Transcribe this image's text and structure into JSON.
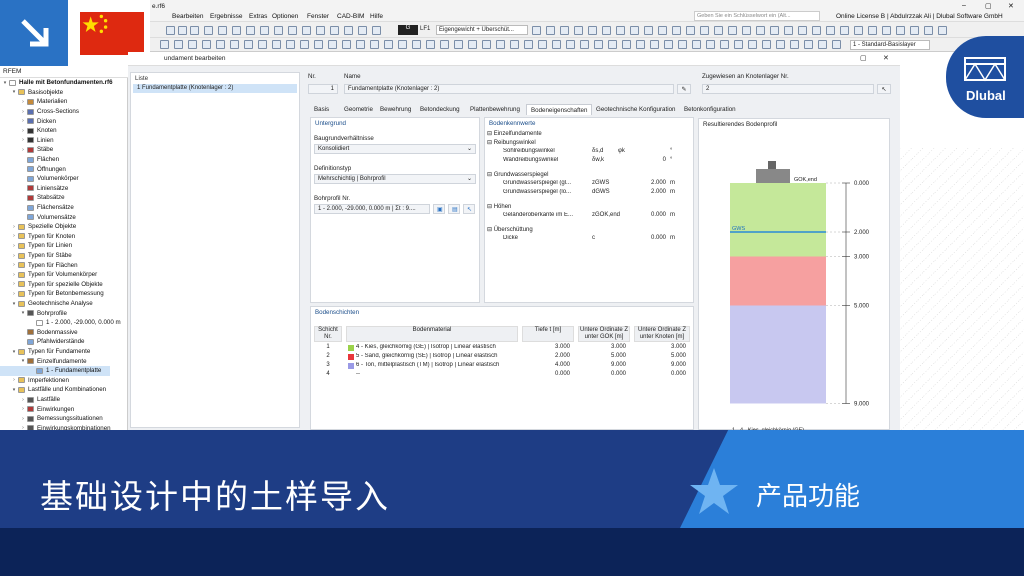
{
  "app": {
    "title_fragment": "e.rf6"
  },
  "menu": [
    "Bearbeiten",
    "Ergebnisse",
    "Extras",
    "Optionen",
    "Fenster",
    "CAD-BIM",
    "Hilfe"
  ],
  "search": {
    "placeholder": "Geben Sie ein Schlüsselwort ein (Alt..."
  },
  "license": "Online License B | Abdulrzzak Ali | Dlubal Software GmbH",
  "toolbar": {
    "lc_code": "G",
    "lc_name": "LF1",
    "lc_desc": "Eigengewicht + Überschüt...",
    "layer": "1 - Standard-Basislayer"
  },
  "navigator": {
    "header": "RFEM",
    "items": [
      {
        "label": "Halle mit Betonfundamenten.rf6",
        "lvl": 0,
        "bold": true,
        "exp": "▾",
        "color": "#ffffff"
      },
      {
        "label": "Basisobjekte",
        "lvl": 1,
        "exp": "▾",
        "color": "#e8c25a"
      },
      {
        "label": "Materialien",
        "lvl": 2,
        "exp": "›",
        "color": "#c58a3a"
      },
      {
        "label": "Cross-Sections",
        "lvl": 2,
        "exp": "›",
        "color": "#5a6fb0"
      },
      {
        "label": "Dicken",
        "lvl": 2,
        "exp": "›",
        "color": "#5a6fb0"
      },
      {
        "label": "Knoten",
        "lvl": 2,
        "exp": "›",
        "color": "#333333"
      },
      {
        "label": "Linien",
        "lvl": 2,
        "exp": "›",
        "color": "#333333"
      },
      {
        "label": "Stäbe",
        "lvl": 2,
        "exp": "›",
        "color": "#b03a3a"
      },
      {
        "label": "Flächen",
        "lvl": 2,
        "exp": "",
        "color": "#7fa6d8"
      },
      {
        "label": "Öffnungen",
        "lvl": 2,
        "exp": "",
        "color": "#7fa6d8"
      },
      {
        "label": "Volumenkörper",
        "lvl": 2,
        "exp": "",
        "color": "#7fa6d8"
      },
      {
        "label": "Liniensätze",
        "lvl": 2,
        "exp": "",
        "color": "#b03a3a"
      },
      {
        "label": "Stabsätze",
        "lvl": 2,
        "exp": "",
        "color": "#b03a3a"
      },
      {
        "label": "Flächensätze",
        "lvl": 2,
        "exp": "",
        "color": "#7fa6d8"
      },
      {
        "label": "Volumensätze",
        "lvl": 2,
        "exp": "",
        "color": "#7fa6d8"
      },
      {
        "label": "Spezielle Objekte",
        "lvl": 1,
        "exp": "›",
        "color": "#e8c25a"
      },
      {
        "label": "Typen für Knoten",
        "lvl": 1,
        "exp": "›",
        "color": "#e8c25a"
      },
      {
        "label": "Typen für Linien",
        "lvl": 1,
        "exp": "›",
        "color": "#e8c25a"
      },
      {
        "label": "Typen für Stäbe",
        "lvl": 1,
        "exp": "›",
        "color": "#e8c25a"
      },
      {
        "label": "Typen für Flächen",
        "lvl": 1,
        "exp": "›",
        "color": "#e8c25a"
      },
      {
        "label": "Typen für Volumenkörper",
        "lvl": 1,
        "exp": "›",
        "color": "#e8c25a"
      },
      {
        "label": "Typen für spezielle Objekte",
        "lvl": 1,
        "exp": "›",
        "color": "#e8c25a"
      },
      {
        "label": "Typen für Betonbemessung",
        "lvl": 1,
        "exp": "›",
        "color": "#e8c25a"
      },
      {
        "label": "Geotechnische Analyse",
        "lvl": 1,
        "exp": "▾",
        "color": "#e8c25a"
      },
      {
        "label": "Bohrprofile",
        "lvl": 2,
        "exp": "▾",
        "color": "#555555"
      },
      {
        "label": "1 - 2.000, -29.000, 0.000 m",
        "lvl": 3,
        "exp": "",
        "color": "#ffffff"
      },
      {
        "label": "Bodenmassive",
        "lvl": 2,
        "exp": "",
        "color": "#a0703a"
      },
      {
        "label": "Pfahlwiderstände",
        "lvl": 2,
        "exp": "",
        "color": "#7fa6d8"
      },
      {
        "label": "Typen für Fundamente",
        "lvl": 1,
        "exp": "▾",
        "color": "#e8c25a"
      },
      {
        "label": "Einzelfundamente",
        "lvl": 2,
        "exp": "▾",
        "color": "#a0703a"
      },
      {
        "label": "1 - Fundamentplatte",
        "lvl": 3,
        "exp": "",
        "color": "#7fa6d8",
        "sel": true
      },
      {
        "label": "Imperfektionen",
        "lvl": 1,
        "exp": "›",
        "color": "#e8c25a"
      },
      {
        "label": "Lastfälle und Kombinationen",
        "lvl": 1,
        "exp": "▾",
        "color": "#e8c25a"
      },
      {
        "label": "Lastfälle",
        "lvl": 2,
        "exp": "›",
        "color": "#555555"
      },
      {
        "label": "Einwirkungen",
        "lvl": 2,
        "exp": "›",
        "color": "#b03a3a"
      },
      {
        "label": "Bemessungssituationen",
        "lvl": 2,
        "exp": "›",
        "color": "#555555"
      },
      {
        "label": "Einwirkungskombinationen",
        "lvl": 2,
        "exp": "›",
        "color": "#555555"
      }
    ]
  },
  "dialog": {
    "title": "undament bearbeiten",
    "list_header": "Liste",
    "list_item": "1   Fundamentplatte (Knotenlager : 2)",
    "no_label": "Nr.",
    "no_value": "1",
    "name_label": "Name",
    "name_value": "Fundamentplatte (Knotenlager : 2)",
    "assign_label": "Zugewiesen an Knotenlager Nr.",
    "assign_value": "2",
    "tabs": [
      "Basis",
      "Geometrie",
      "Bewehrung",
      "Betondeckung",
      "Plattenbewehrung",
      "Bodeneigenschaften",
      "Geotechnische Konfiguration",
      "Betonkonfiguration"
    ],
    "active_tab": 5,
    "untergrund": {
      "header": "Untergrund",
      "soil_label": "Baugrundverhältnisse",
      "soil_value": "Konsolidiert",
      "def_label": "Definitionstyp",
      "def_value": "Mehrschichtig | Bohrprofil",
      "bore_label": "Bohrprofil Nr.",
      "bore_value": "1 - 2.000, -29.000, 0.000 m | Σt : 9...."
    },
    "kennwerte": {
      "header": "Bodenkennwerte",
      "groups": [
        {
          "title": "Einzelfundamente",
          "rows": []
        },
        {
          "title": "Reibungswinkel",
          "rows": [
            {
              "name": "Sohlreibungswinkel",
              "sym": "δs,d",
              "val": "φk",
              "unit": "°"
            },
            {
              "name": "Wandreibungswinkel",
              "sym": "δw,k",
              "val": "0",
              "unit": "°"
            }
          ]
        },
        {
          "title": "Grundwasserspiegel",
          "rows": [
            {
              "name": "Grundwasserspiegel (gl...",
              "sym": "zGWS",
              "val": "2.000",
              "unit": "m"
            },
            {
              "name": "Grundwasserspiegel (lo...",
              "sym": "dGWS",
              "val": "2.000",
              "unit": "m"
            }
          ]
        },
        {
          "title": "Höhen",
          "rows": [
            {
              "name": "Geländeroberkante im E...",
              "sym": "zGOK,end",
              "val": "0.000",
              "unit": "m"
            }
          ]
        },
        {
          "title": "Überschüttung",
          "rows": [
            {
              "name": "Dicke",
              "sym": "c",
              "val": "0.000",
              "unit": "m"
            }
          ]
        }
      ]
    },
    "schichten": {
      "header": "Bodenschichten",
      "columns": [
        "Schicht Nr.",
        "Bodenmaterial",
        "Tiefe t [m]",
        "Untere Ordinate Z unter GOK [m]",
        "Untere Ordinate Z unter Knoten [m]"
      ],
      "rows": [
        {
          "nr": "1",
          "mat": "4 - Kies, gleichkörnig (GE) | Isotrop | Linear elastisch",
          "color": "#9bd24a",
          "t": "3.000",
          "z1": "3.000",
          "z2": "3.000"
        },
        {
          "nr": "2",
          "mat": "5 - Sand, gleichkörnig (SE) | Isotrop | Linear elastisch",
          "color": "#e8363b",
          "t": "2.000",
          "z1": "5.000",
          "z2": "5.000"
        },
        {
          "nr": "3",
          "mat": "6 - Ton, mittelplastisch (TM) | Isotrop | Linear elastisch",
          "color": "#9a9ae6",
          "t": "4.000",
          "z1": "9.000",
          "z2": "9.000"
        },
        {
          "nr": "4",
          "mat": "--",
          "color": "",
          "t": "0.000",
          "z1": "0.000",
          "z2": "0.000"
        }
      ]
    },
    "profile": {
      "header": "Resultierendes Bodenprofil",
      "gok": "GOK,end",
      "gws": "GWS",
      "ticks": [
        "0.000",
        "2.000",
        "3.000",
        "5.000",
        "9.000"
      ],
      "tick_values": [
        0,
        2,
        3,
        5,
        9
      ],
      "caption": "1 - 4 - Kies, gleichkörnig (GE)",
      "layer_colors": [
        "#c5e89a",
        "#f6a0a0",
        "#c8c8f0"
      ]
    }
  },
  "banner": {
    "title": "基础设计中的土样导入",
    "label": "产品功能",
    "logo": "Dlubal"
  },
  "colors": {
    "banner": "#1e3d85",
    "accent": "#2b7fd9",
    "logo": "#1f4fa0"
  }
}
